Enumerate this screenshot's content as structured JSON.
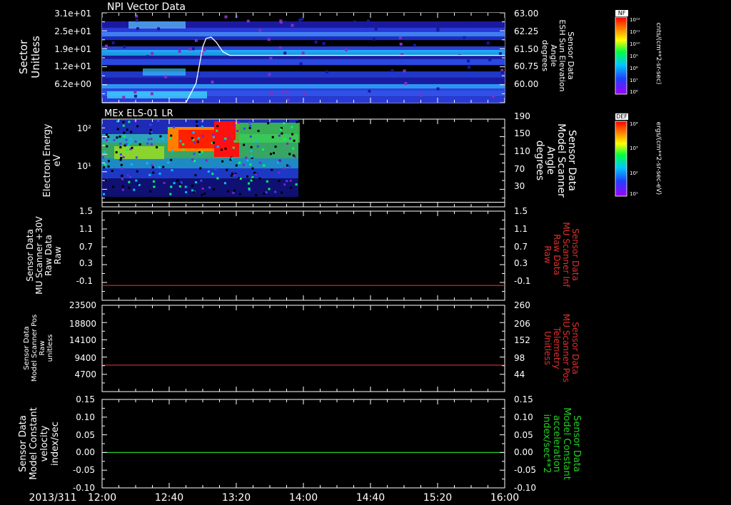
{
  "date_label": "2013/311",
  "x_ticks": [
    "12:00",
    "12:40",
    "13:20",
    "14:00",
    "14:40",
    "15:20",
    "16:00"
  ],
  "panels": [
    {
      "id": "npi",
      "title": "NPI Vector Data",
      "left_label": [
        "Sector",
        "Unitless"
      ],
      "left_ticks": [
        "3.1e+01",
        "2.5e+01",
        "1.9e+01",
        "1.2e+01",
        "6.2e+00"
      ],
      "right_label": [
        "Sensor Data",
        "ESH Sun Elevation",
        "Angle",
        "degrees"
      ],
      "right_ticks": [
        "63.00",
        "62.25",
        "61.50",
        "60.75",
        "60.00"
      ],
      "colorbar": {
        "label": "NF",
        "ticks": [
          "10¹²",
          "10¹¹",
          "10¹⁰",
          "10⁹",
          "10⁸",
          "10⁷",
          "10⁶"
        ],
        "unit": "cnts/(cm**2-sr-sec)"
      }
    },
    {
      "id": "els",
      "title": "MEx ELS-01 LR",
      "left_label": [
        "Electron Energy",
        "eV"
      ],
      "left_ticks": [
        "10²",
        "10¹"
      ],
      "right_label": [
        "Sensor Data",
        "Model Scanner",
        "Angle",
        "degrees"
      ],
      "right_ticks": [
        "190",
        "150",
        "110",
        "70",
        "30"
      ],
      "colorbar": {
        "label": "DEF",
        "ticks": [
          "10⁴",
          "10³",
          "10²",
          "10¹"
        ],
        "unit": "ergs/(cm**2-sr-sec-eV)"
      }
    },
    {
      "id": "mu_raw",
      "left_label": [
        "Sensor Data",
        "MU Scanner +30V",
        "Raw Data",
        "Raw"
      ],
      "left_ticks": [
        "1.5",
        "1.1",
        "0.7",
        "0.3",
        "-0.1"
      ],
      "right_label": [
        "Sensor Data",
        "MU Scanner Inf",
        "Raw Data",
        "Raw"
      ],
      "right_ticks": [
        "1.5",
        "1.1",
        "0.7",
        "0.3",
        "-0.1"
      ]
    },
    {
      "id": "scanner_pos",
      "left_label": [
        "Sensor Data",
        "Model Scanner Pos",
        "Raw",
        "unitless"
      ],
      "left_ticks": [
        "23500",
        "18800",
        "14100",
        "9400",
        "4700"
      ],
      "right_label": [
        "Sensor Data",
        "MU Scanner Pos",
        "Telemetry",
        "Unitless"
      ],
      "right_ticks": [
        "260",
        "206",
        "152",
        "98",
        "44"
      ]
    },
    {
      "id": "constant",
      "left_label": [
        "Sensor Data",
        "Model Constant",
        "velocity",
        "index/sec"
      ],
      "left_ticks": [
        "0.15",
        "0.10",
        "0.05",
        "0.00",
        "-0.05",
        "-0.10"
      ],
      "right_label": [
        "Sensor Data",
        "Model Constant",
        "acceleration",
        "index/sec**2"
      ],
      "right_ticks": [
        "0.15",
        "0.10",
        "0.05",
        "0.00",
        "-0.05",
        "-0.10"
      ]
    }
  ],
  "colors": {
    "red_line": "#e0302c",
    "green_line": "#22d022",
    "white_line": "#ffffff"
  },
  "chart_data": [
    {
      "type": "heatmap",
      "title": "NPI Vector Data",
      "ylabel": "Sector Unitless",
      "y_ticks": [
        31,
        25,
        19,
        12,
        6.2
      ],
      "x_range": [
        "12:00",
        "16:00"
      ],
      "overlay_line": {
        "name": "ESH Sun Elevation Angle",
        "ylim": [
          59.6,
          63.3
        ],
        "x": [
          "12:00",
          "12:50",
          "12:56",
          "13:00",
          "13:02",
          "13:05",
          "13:08",
          "13:12",
          "13:16",
          "13:25",
          "14:00",
          "16:00"
        ],
        "y": [
          59.6,
          59.6,
          60.4,
          61.9,
          62.25,
          62.3,
          62.1,
          61.7,
          61.55,
          61.55,
          61.55,
          61.55
        ]
      }
    },
    {
      "type": "heatmap",
      "title": "MEx ELS-01 LR",
      "ylabel": "Electron Energy eV",
      "y_scale": "log",
      "data_extent": [
        "12:00",
        "13:57"
      ],
      "overlay_line": {
        "name": "Model Scanner Angle",
        "ylim": [
          0,
          190
        ],
        "value": 10
      }
    },
    {
      "type": "line",
      "ylim": [
        -0.3,
        1.5
      ],
      "series": [
        {
          "name": "MU Scanner Raw",
          "color": "red",
          "x": [
            "12:00",
            "16:00"
          ],
          "y": [
            0.0,
            0.0
          ]
        }
      ]
    },
    {
      "type": "line",
      "ylim": [
        0,
        23500
      ],
      "series": [
        {
          "name": "Scanner Pos",
          "color": "red",
          "x": [
            "12:00",
            "16:00"
          ],
          "y": [
            7200,
            7200
          ]
        }
      ]
    },
    {
      "type": "line",
      "ylim": [
        -0.1,
        0.15
      ],
      "series": [
        {
          "name": "Model Constant",
          "color": "green",
          "x": [
            "12:00",
            "16:00"
          ],
          "y": [
            0.0,
            0.0
          ]
        }
      ]
    }
  ]
}
